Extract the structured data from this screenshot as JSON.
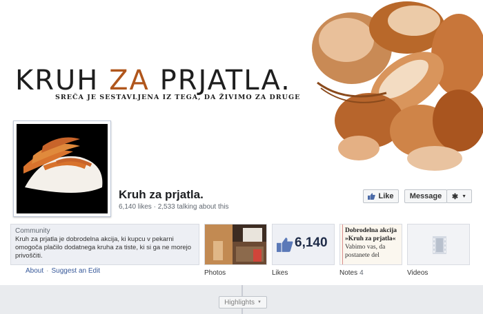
{
  "cover": {
    "title_part1": "KRUH ",
    "title_accent": "ZA",
    "title_part2": " PRJATLA.",
    "subtitle": "SREČA JE SESTAVLJENA IZ TEGA, DA ŽIVIMO ZA DRUGE"
  },
  "page": {
    "name": "Kruh za prjatla.",
    "likes": "6,140 likes",
    "stats_separator": " · ",
    "talking": "2,533 talking about this"
  },
  "actions": {
    "like_label": "Like",
    "message_label": "Message"
  },
  "about": {
    "category": "Community",
    "description": "Kruh za prjatla je dobrodelna akcija, ki kupcu v pekarni omogoča plačilo dodatnega kruha za tiste, ki si ga ne morejo privoščiti.",
    "about_link": "About",
    "link_separator": "·",
    "suggest_link": "Suggest an Edit"
  },
  "tiles": {
    "photos_label": "Photos",
    "likes_value": "6,140",
    "likes_label": "Likes",
    "notes_label": "Notes",
    "notes_count": "4",
    "note_line1": "Dobrodelna akcija",
    "note_line2": "»Kruh za prjatla«",
    "note_line3": "Vabimo vas, da",
    "note_line4": "postanete del",
    "videos_label": "Videos"
  },
  "timeline": {
    "highlights_label": "Highlights"
  },
  "colors": {
    "brand_blue": "#365899",
    "accent_brown": "#b0561c",
    "background": "#e9ebee"
  }
}
